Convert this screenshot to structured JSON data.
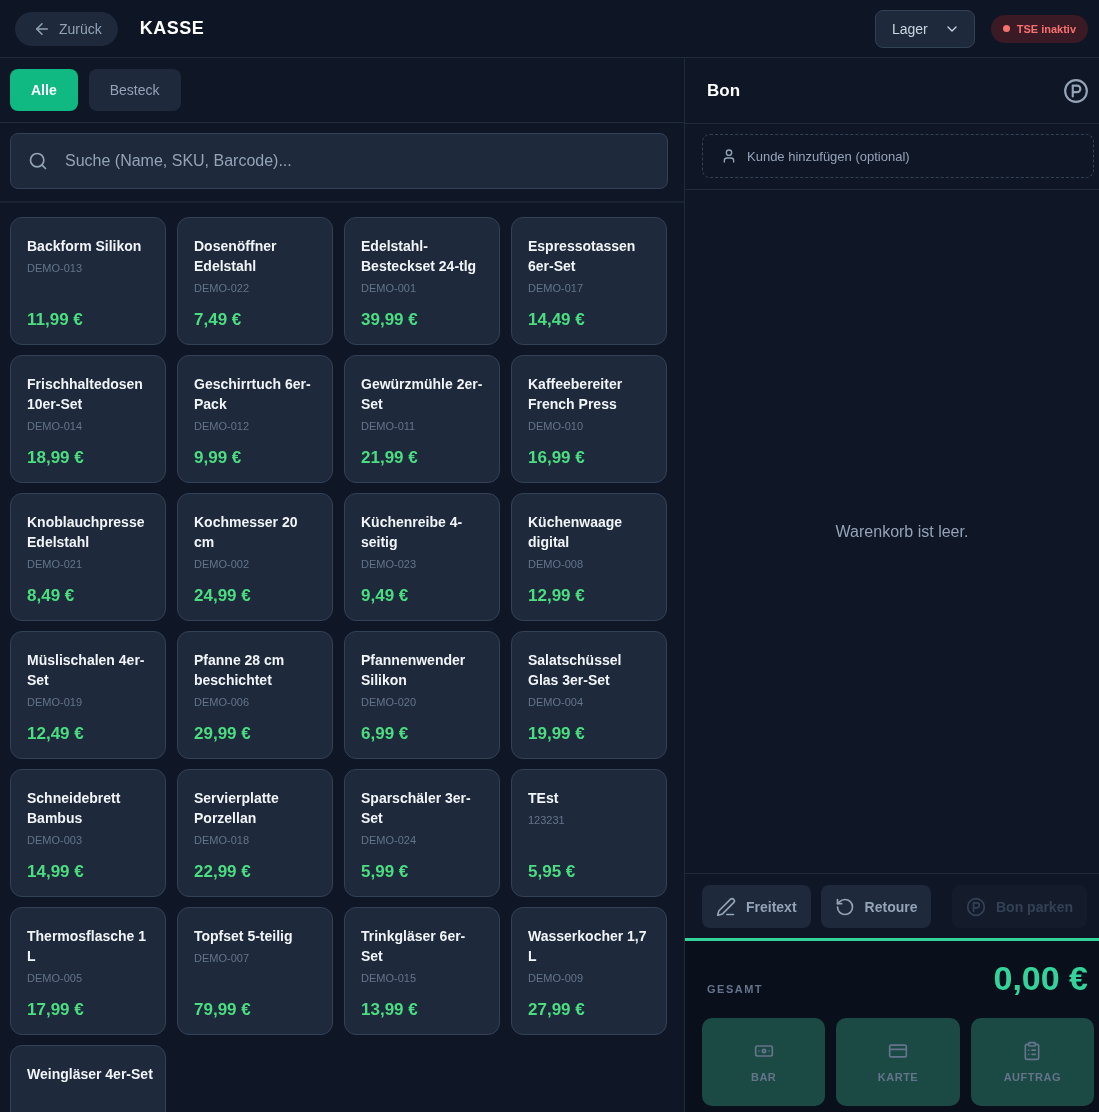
{
  "header": {
    "back_label": "Zurück",
    "title": "KASSE",
    "location_select": "Lager",
    "tse_status": "TSE inaktiv"
  },
  "categories": [
    {
      "label": "Alle",
      "selected": true
    },
    {
      "label": "Besteck",
      "selected": false
    }
  ],
  "search": {
    "placeholder": "Suche (Name, SKU, Barcode)..."
  },
  "products": [
    {
      "name": "Backform Silikon",
      "sku": "DEMO-013",
      "price": "11,99 €"
    },
    {
      "name": "Dosenöffner Edelstahl",
      "sku": "DEMO-022",
      "price": "7,49 €"
    },
    {
      "name": "Edelstahl-Besteckset 24-tlg",
      "sku": "DEMO-001",
      "price": "39,99 €"
    },
    {
      "name": "Espressotassen 6er-Set",
      "sku": "DEMO-017",
      "price": "14,49 €"
    },
    {
      "name": "Frischhaltedosen 10er-Set",
      "sku": "DEMO-014",
      "price": "18,99 €"
    },
    {
      "name": "Geschirrtuch 6er-Pack",
      "sku": "DEMO-012",
      "price": "9,99 €"
    },
    {
      "name": "Gewürzmühle 2er-Set",
      "sku": "DEMO-011",
      "price": "21,99 €"
    },
    {
      "name": "Kaffeebereiter French Press",
      "sku": "DEMO-010",
      "price": "16,99 €"
    },
    {
      "name": "Knoblauchpresse Edelstahl",
      "sku": "DEMO-021",
      "price": "8,49 €"
    },
    {
      "name": "Kochmesser 20 cm",
      "sku": "DEMO-002",
      "price": "24,99 €"
    },
    {
      "name": "Küchenreibe 4-seitig",
      "sku": "DEMO-023",
      "price": "9,49 €"
    },
    {
      "name": "Küchenwaage digital",
      "sku": "DEMO-008",
      "price": "12,99 €"
    },
    {
      "name": "Müslischalen 4er-Set",
      "sku": "DEMO-019",
      "price": "12,49 €"
    },
    {
      "name": "Pfanne 28 cm beschichtet",
      "sku": "DEMO-006",
      "price": "29,99 €"
    },
    {
      "name": "Pfannenwender Silikon",
      "sku": "DEMO-020",
      "price": "6,99 €"
    },
    {
      "name": "Salatschüssel Glas 3er-Set",
      "sku": "DEMO-004",
      "price": "19,99 €"
    },
    {
      "name": "Schneidebrett Bambus",
      "sku": "DEMO-003",
      "price": "14,99 €"
    },
    {
      "name": "Servierplatte Porzellan",
      "sku": "DEMO-018",
      "price": "22,99 €"
    },
    {
      "name": "Sparschäler 3er-Set",
      "sku": "DEMO-024",
      "price": "5,99 €"
    },
    {
      "name": "TEst",
      "sku": "123231",
      "price": "5,95 €"
    },
    {
      "name": "Thermosflasche 1 L",
      "sku": "DEMO-005",
      "price": "17,99 €"
    },
    {
      "name": "Topfset 5-teilig",
      "sku": "DEMO-007",
      "price": "79,99 €"
    },
    {
      "name": "Trinkgläser 6er-Set",
      "sku": "DEMO-015",
      "price": "13,99 €"
    },
    {
      "name": "Wasserkocher 1,7 L",
      "sku": "DEMO-009",
      "price": "27,99 €"
    },
    {
      "name": "Weingläser 4er-Set"
    }
  ],
  "receipt": {
    "title": "Bon",
    "customer_placeholder": "Kunde hinzufügen (optional)",
    "empty_message": "Warenkorb ist leer.",
    "actions": [
      {
        "kind": "freetext",
        "label": "Freitext",
        "disabled": false
      },
      {
        "kind": "return",
        "label": "Retoure",
        "disabled": false
      },
      {
        "kind": "park",
        "label": "Bon parken",
        "disabled": true
      }
    ],
    "total_label": "GESAMT",
    "total": "0,00 €",
    "payments": [
      {
        "kind": "cash",
        "label": "BAR",
        "disabled": true
      },
      {
        "kind": "card",
        "label": "KARTE",
        "disabled": true
      },
      {
        "kind": "order",
        "label": "AUFTRAG",
        "disabled": true
      }
    ]
  }
}
